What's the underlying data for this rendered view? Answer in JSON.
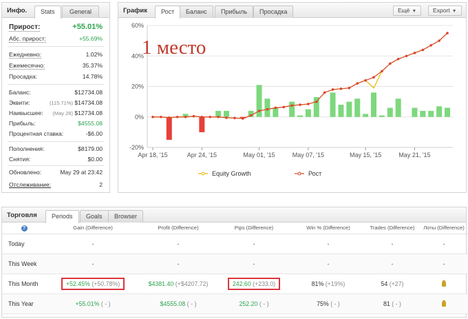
{
  "info_panel": {
    "title": "Инфо.",
    "tabs": [
      {
        "label": "Stats"
      },
      {
        "label": "General"
      }
    ],
    "rows": [
      {
        "label": "Прирост:",
        "value": "+55.01%"
      },
      {
        "label": "Абс. прирост:",
        "value": "+55.69%"
      },
      {
        "label": "Ежедневно:",
        "value": "1.02%"
      },
      {
        "label": "Ежемесячно:",
        "value": "35.37%"
      },
      {
        "label": "Просадка:",
        "value": "14.78%"
      },
      {
        "label": "Баланс:",
        "value": "$12734.08"
      },
      {
        "label": "Эквити:",
        "note": "(115.71%)",
        "value": "$14734.08"
      },
      {
        "label": "Наивысшее:",
        "note": "(May 28)",
        "value": "$12734.08"
      },
      {
        "label": "Прибыль:",
        "value": "$4555.08"
      },
      {
        "label": "Процентная ставка:",
        "value": "-$6.00"
      },
      {
        "label": "Пополнения:",
        "value": "$8179.00"
      },
      {
        "label": "Снятия:",
        "value": "$0.00"
      },
      {
        "label": "Обновлено:",
        "value": "May 29 at 23:42"
      },
      {
        "label": "Отслеживание:",
        "value": "2"
      }
    ]
  },
  "chart_panel": {
    "title": "График",
    "tabs": [
      {
        "label": "Рост"
      },
      {
        "label": "Баланс"
      },
      {
        "label": "Прибыль"
      },
      {
        "label": "Просадка"
      }
    ],
    "buttons": {
      "more": "Ещё",
      "export": "Export"
    },
    "overlay_text": "1 место"
  },
  "chart_data": {
    "type": "line",
    "y_ticks": [
      "60%",
      "40%",
      "20%",
      "0%",
      "-20%"
    ],
    "x_ticks": [
      "Apr 18, '15",
      "Apr 24, '15",
      "May 01, '15",
      "May 07, '15",
      "May 15, '15",
      "May 21, '15"
    ],
    "x_tick_index": [
      0,
      6,
      13,
      19,
      26,
      32
    ],
    "ylim": [
      -20,
      60
    ],
    "legend": [
      {
        "name": "Equity Growth",
        "color": "#e6b800"
      },
      {
        "name": "Рост",
        "color": "#d9472b"
      }
    ],
    "series": [
      {
        "name": "Рост",
        "color": "#d9472b",
        "values": [
          0,
          0,
          -0.5,
          0,
          0,
          0.5,
          0,
          0,
          0,
          -0.5,
          -0.7,
          -1,
          1,
          4,
          5,
          6,
          6.5,
          7.5,
          8,
          8.5,
          10,
          16,
          18,
          18.5,
          19,
          22,
          24,
          26,
          30,
          35,
          38,
          40,
          42,
          44,
          47,
          50,
          55
        ]
      },
      {
        "name": "Equity Growth",
        "color": "#e6b800",
        "values": [
          0,
          0,
          -0.5,
          0,
          0,
          0.5,
          0,
          0,
          0,
          -0.5,
          -0.7,
          -1,
          1,
          4,
          5,
          6,
          6.5,
          7.5,
          8,
          8.5,
          10,
          16,
          18,
          18.5,
          19,
          22,
          24,
          19,
          30,
          35,
          38,
          40,
          42,
          44,
          47,
          50,
          55
        ]
      }
    ],
    "bars": [
      0,
      0,
      -15,
      0,
      2,
      0,
      -10,
      0,
      4,
      4,
      0,
      -1,
      4,
      21,
      12,
      6,
      0,
      10,
      1,
      5,
      13,
      0,
      16,
      8,
      10,
      12,
      2,
      16,
      1,
      6,
      12,
      0,
      6,
      4,
      4,
      7,
      6
    ]
  },
  "trading_panel": {
    "title": "Торговля",
    "tabs": [
      {
        "label": "Periods"
      },
      {
        "label": "Goals"
      },
      {
        "label": "Browser"
      }
    ],
    "help_icon": "?",
    "headers": [
      "Gain (Difference)",
      "Profit (Difference)",
      "Pips (Difference)",
      "Win % (Difference)",
      "Trades (Difference)",
      "Лоты (Difference)"
    ],
    "rows": [
      {
        "label": "Today",
        "gain": "-",
        "profit": "-",
        "pips": "-",
        "win": "-",
        "trades": "-",
        "lots": "-"
      },
      {
        "label": "This Week",
        "gain": "-",
        "profit": "-",
        "pips": "-",
        "win": "-",
        "trades": "-",
        "lots": "-"
      },
      {
        "label": "This Month",
        "gain": "+52.45%",
        "gain_diff": "(+50.78%)",
        "profit": "$4381.40",
        "profit_diff": "(+$4207.72)",
        "pips": "242.60",
        "pips_diff": "(+233.0)",
        "win": "81%",
        "win_diff": "(+19%)",
        "trades": "54",
        "trades_diff": "(+27)"
      },
      {
        "label": "This Year",
        "gain": "+55.01%",
        "gain_diff": "( - )",
        "profit": "$4555.08",
        "profit_diff": "( - )",
        "pips": "252.20",
        "pips_diff": "( - )",
        "win": "75%",
        "win_diff": "( - )",
        "trades": "81",
        "trades_diff": "( - )"
      }
    ]
  }
}
